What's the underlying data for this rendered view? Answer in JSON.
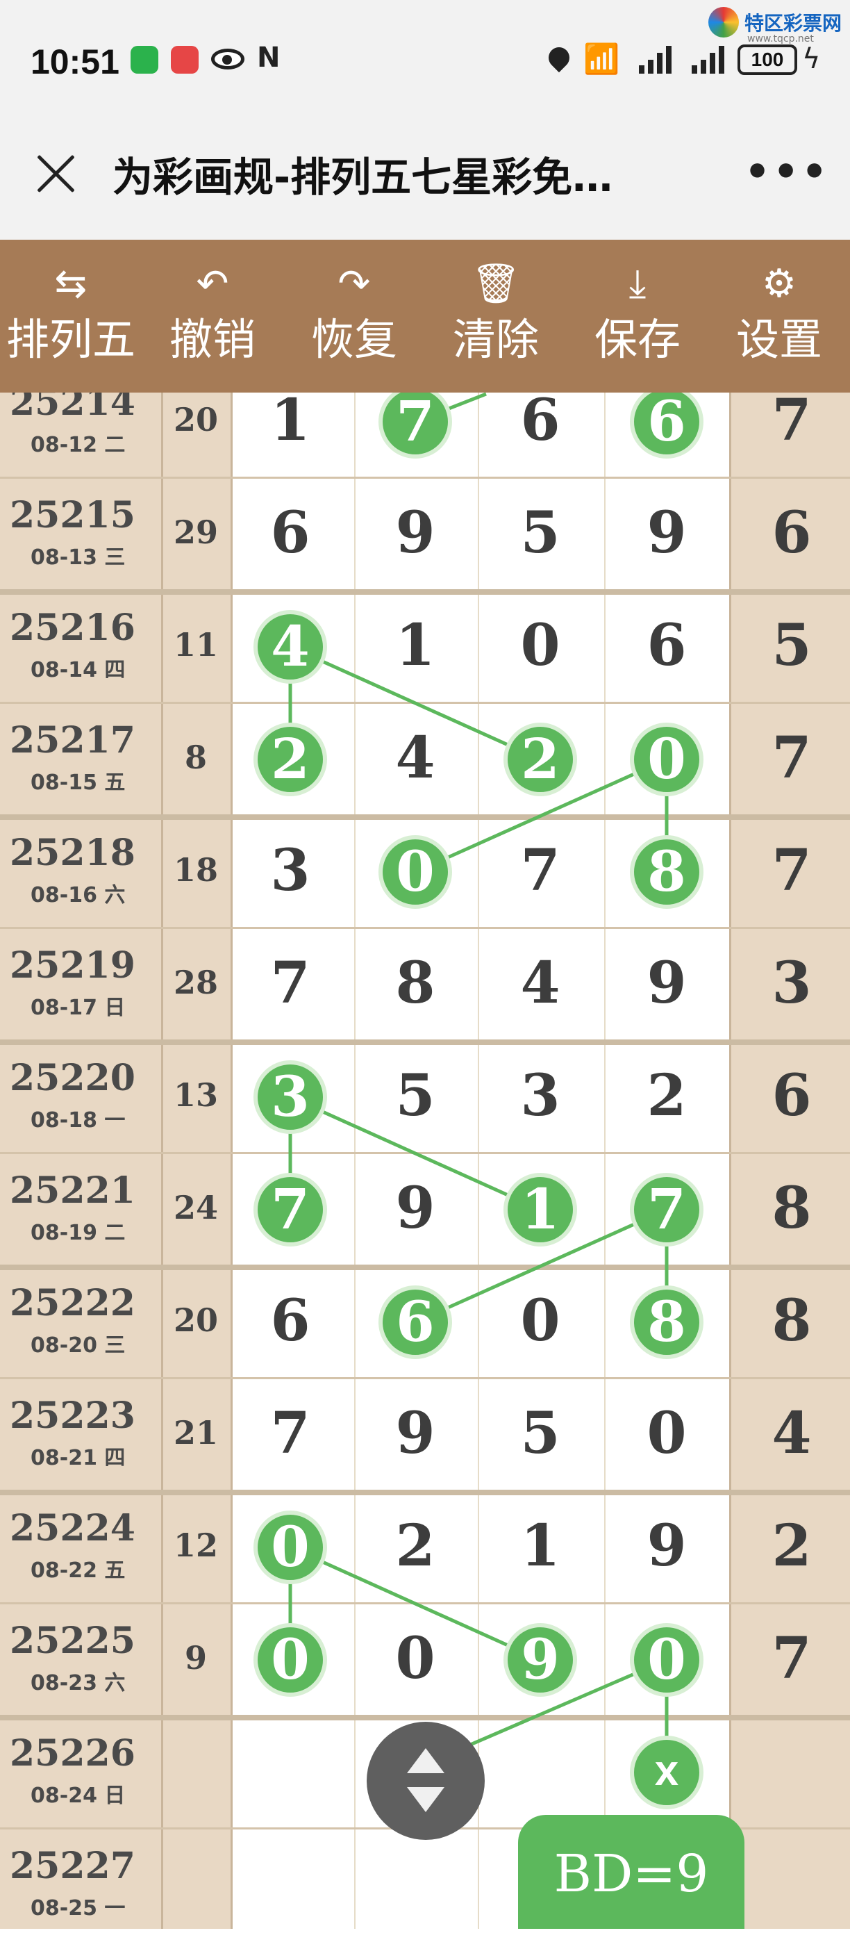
{
  "status_bar": {
    "time": "10:51",
    "battery": "100",
    "icons": [
      "wechat-icon",
      "red-app-icon",
      "eye-icon",
      "nfc-icon",
      "location-icon",
      "wifi-icon",
      "signal-icon",
      "signal-icon",
      "battery-icon",
      "charging-icon"
    ]
  },
  "brand": {
    "name": "特区彩票网",
    "url": "www.tqcp.net"
  },
  "title_bar": {
    "title": "为彩画规-排列五七星彩免…",
    "more": "•••"
  },
  "toolbar": {
    "items": [
      {
        "label": "排列五",
        "icon": "swap-icon",
        "glyph": "⇆"
      },
      {
        "label": "撤销",
        "icon": "undo-icon",
        "glyph": "↶"
      },
      {
        "label": "恢复",
        "icon": "redo-icon",
        "glyph": "↷"
      },
      {
        "label": "清除",
        "icon": "trash-icon",
        "glyph": "🗑"
      },
      {
        "label": "保存",
        "icon": "download-icon",
        "glyph": "⤓"
      },
      {
        "label": "设置",
        "icon": "gear-icon",
        "glyph": "⚙"
      }
    ]
  },
  "rows": [
    {
      "period": "25214",
      "date": "08-12 二",
      "sum": "20",
      "digits": [
        "1",
        "7",
        "6",
        "6",
        "7"
      ]
    },
    {
      "period": "25215",
      "date": "08-13 三",
      "sum": "29",
      "digits": [
        "6",
        "9",
        "5",
        "9",
        "6"
      ]
    },
    {
      "period": "25216",
      "date": "08-14 四",
      "sum": "11",
      "digits": [
        "4",
        "1",
        "0",
        "6",
        "5"
      ]
    },
    {
      "period": "25217",
      "date": "08-15 五",
      "sum": "8",
      "digits": [
        "2",
        "4",
        "2",
        "0",
        "7"
      ]
    },
    {
      "period": "25218",
      "date": "08-16 六",
      "sum": "18",
      "digits": [
        "3",
        "0",
        "7",
        "8",
        "7"
      ]
    },
    {
      "period": "25219",
      "date": "08-17 日",
      "sum": "28",
      "digits": [
        "7",
        "8",
        "4",
        "9",
        "3"
      ]
    },
    {
      "period": "25220",
      "date": "08-18 一",
      "sum": "13",
      "digits": [
        "3",
        "5",
        "3",
        "2",
        "6"
      ]
    },
    {
      "period": "25221",
      "date": "08-19 二",
      "sum": "24",
      "digits": [
        "7",
        "9",
        "1",
        "7",
        "8"
      ]
    },
    {
      "period": "25222",
      "date": "08-20 三",
      "sum": "20",
      "digits": [
        "6",
        "6",
        "0",
        "8",
        "8"
      ]
    },
    {
      "period": "25223",
      "date": "08-21 四",
      "sum": "21",
      "digits": [
        "7",
        "9",
        "5",
        "0",
        "4"
      ]
    },
    {
      "period": "25224",
      "date": "08-22 五",
      "sum": "12",
      "digits": [
        "0",
        "2",
        "1",
        "9",
        "2"
      ]
    },
    {
      "period": "25225",
      "date": "08-23 六",
      "sum": "9",
      "digits": [
        "0",
        "0",
        "9",
        "0",
        "7"
      ]
    },
    {
      "period": "25226",
      "date": "08-24 日",
      "sum": "",
      "digits": [
        "",
        "",
        "",
        "x",
        ""
      ]
    },
    {
      "period": "25227",
      "date": "08-25 一",
      "sum": "",
      "digits": [
        "",
        "",
        "",
        "",
        ""
      ]
    }
  ],
  "highlights": [
    [
      0,
      1
    ],
    [
      0,
      3
    ],
    [
      2,
      0
    ],
    [
      3,
      0
    ],
    [
      3,
      2
    ],
    [
      3,
      3
    ],
    [
      4,
      1
    ],
    [
      4,
      3
    ],
    [
      6,
      0
    ],
    [
      7,
      0
    ],
    [
      7,
      2
    ],
    [
      7,
      3
    ],
    [
      8,
      1
    ],
    [
      8,
      3
    ],
    [
      10,
      0
    ],
    [
      11,
      0
    ],
    [
      11,
      2
    ],
    [
      11,
      3
    ],
    [
      12,
      3
    ]
  ],
  "links": [
    [
      [
        2,
        0
      ],
      [
        3,
        0
      ]
    ],
    [
      [
        2,
        0
      ],
      [
        3,
        2
      ]
    ],
    [
      [
        3,
        3
      ],
      [
        4,
        1
      ]
    ],
    [
      [
        3,
        3
      ],
      [
        4,
        3
      ]
    ],
    [
      [
        6,
        0
      ],
      [
        7,
        0
      ]
    ],
    [
      [
        6,
        0
      ],
      [
        7,
        2
      ]
    ],
    [
      [
        7,
        3
      ],
      [
        8,
        1
      ]
    ],
    [
      [
        7,
        3
      ],
      [
        8,
        3
      ]
    ],
    [
      [
        10,
        0
      ],
      [
        11,
        0
      ]
    ],
    [
      [
        10,
        0
      ],
      [
        11,
        2
      ]
    ],
    [
      [
        11,
        3
      ],
      [
        12,
        3
      ]
    ]
  ],
  "scroll_handle": "up-down-icon",
  "badge": {
    "label": "BD=9"
  }
}
